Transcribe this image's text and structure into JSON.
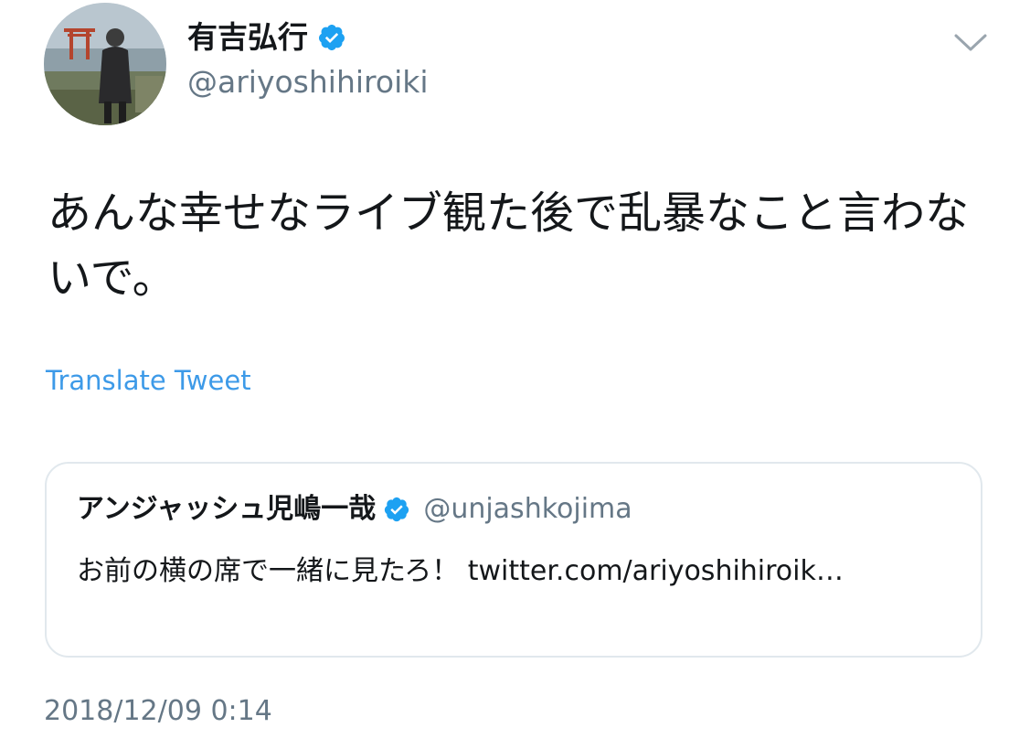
{
  "author": {
    "display_name": "有吉弘行",
    "handle": "@ariyoshihiroiki",
    "verified": true
  },
  "tweet": {
    "text": "あんな幸せなライブ観た後で乱暴なこと言わないで。",
    "translate_label": "Translate Tweet",
    "timestamp": "2018/12/09 0:14"
  },
  "quoted_tweet": {
    "display_name": "アンジャッシュ児嶋一哉",
    "handle": "@unjashkojima",
    "verified": true,
    "text": "お前の横の席で一緒に見たろ！ twitter.com/ariyoshihiroik…"
  },
  "icons": {
    "verified": "verified-badge-icon",
    "menu": "chevron-down-icon"
  },
  "colors": {
    "link": "#3d9ae8",
    "verified": "#1da1f2",
    "secondary_text": "#657786",
    "border": "#e1e8ed"
  }
}
